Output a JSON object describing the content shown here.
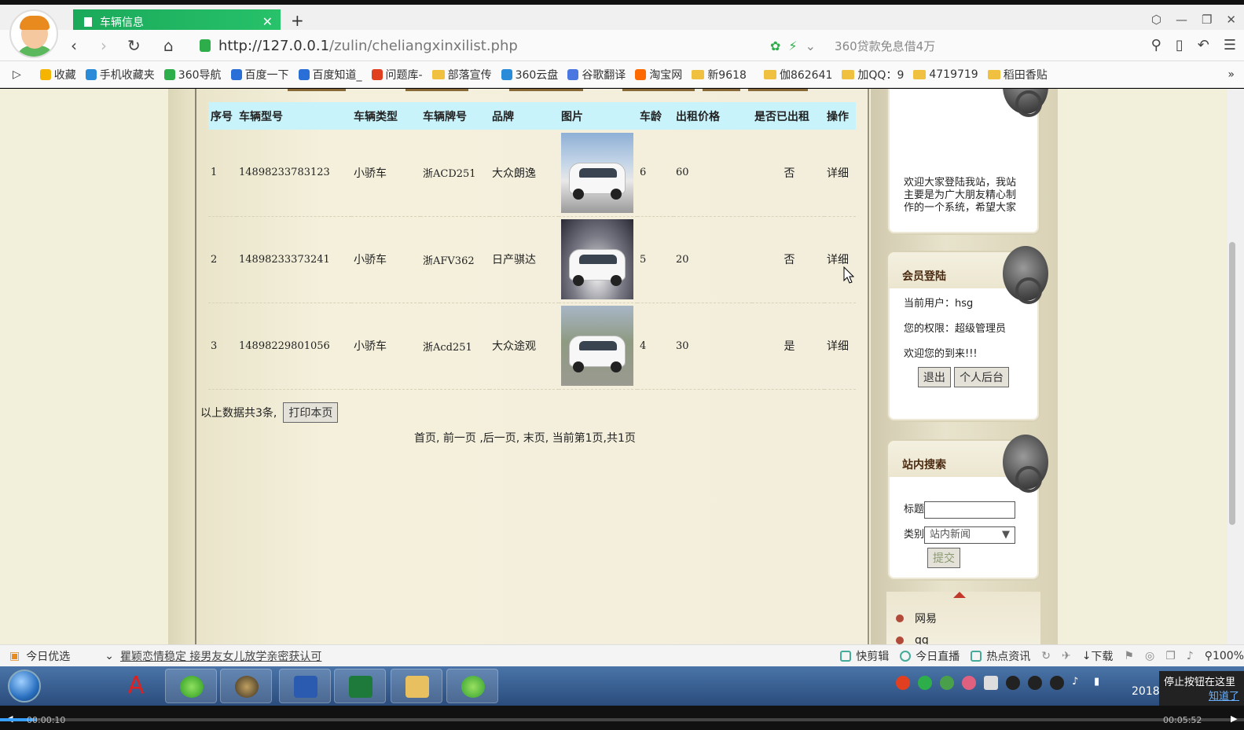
{
  "browser": {
    "tab_title": "车辆信息",
    "url_host": "http://127.0.0.1",
    "url_path": "/zulin/cheliangxinxilist.php",
    "ad_text": "360贷款免息借4万"
  },
  "bookmarks": [
    {
      "label": "收藏",
      "icon": "star-icon",
      "color": "#f5b400"
    },
    {
      "label": "手机收藏夹",
      "icon": "phone-icon",
      "color": "#2a8bd8"
    },
    {
      "label": "360导航",
      "icon": "plus-circle-icon",
      "color": "#2eae4b"
    },
    {
      "label": "百度一下",
      "icon": "paw-icon",
      "color": "#2a6ed8"
    },
    {
      "label": "百度知道_",
      "icon": "paw-icon",
      "color": "#2a6ed8"
    },
    {
      "label": "问题库-",
      "icon": "s-logo-icon",
      "color": "#e04020"
    },
    {
      "label": "部落宣传",
      "icon": "folder-icon",
      "color": "#f0c040"
    },
    {
      "label": "360云盘",
      "icon": "cloud-icon",
      "color": "#2a8bd8"
    },
    {
      "label": "谷歌翻译",
      "icon": "translate-icon",
      "color": "#4a78e0"
    },
    {
      "label": "淘宝网",
      "icon": "taobao-icon",
      "color": "#ff6a00"
    },
    {
      "label": "新9618",
      "icon": "folder-icon",
      "color": "#f0c040"
    },
    {
      "label": "伽862641",
      "icon": "folder-icon",
      "color": "#f0c040"
    },
    {
      "label": "加QQ：9",
      "icon": "folder-icon",
      "color": "#f0c040"
    },
    {
      "label": "4719719",
      "icon": "folder-icon",
      "color": "#f0c040"
    },
    {
      "label": "稻田香贴",
      "icon": "folder-icon",
      "color": "#f0c040"
    }
  ],
  "table": {
    "headers": [
      "序号",
      "车辆型号",
      "车辆类型",
      "车辆牌号",
      "品牌",
      "图片",
      "车龄",
      "出租价格",
      "是否已出租",
      "操作"
    ],
    "rows": [
      {
        "no": "1",
        "model": "14898233783123",
        "type": "小骄车",
        "plate": "浙ACD251",
        "brand": "大众朗逸",
        "age": "6",
        "price": "60",
        "rented": "否",
        "action": "详细"
      },
      {
        "no": "2",
        "model": "14898233373241",
        "type": "小骄车",
        "plate": "浙AFV362",
        "brand": "日产骐达",
        "age": "5",
        "price": "20",
        "rented": "否",
        "action": "详细"
      },
      {
        "no": "3",
        "model": "14898229801056",
        "type": "小骄车",
        "plate": "浙Acd251",
        "brand": "大众途观",
        "age": "4",
        "price": "30",
        "rented": "是",
        "action": "详细"
      }
    ]
  },
  "summary": {
    "text": "以上数据共3条,",
    "print_label": "打印本页"
  },
  "pager": {
    "text": "首页, 前一页 ,后一页, 末页, 当前第1页,共1页"
  },
  "sidebar": {
    "welcome_text": "欢迎大家登陆我站，我站主要是为广大朋友精心制作的一个系统，希望大家",
    "login": {
      "title": "会员登陆",
      "current_user": "当前用户：hsg",
      "permission": "您的权限：超级管理员",
      "welcome": "欢迎您的到来!!!",
      "logout_label": "退出",
      "backend_label": "个人后台"
    },
    "search": {
      "title": "站内搜索",
      "title_label": "标题",
      "category_label": "类别",
      "category_value": "站内新闻",
      "submit_label": "提交"
    },
    "links": [
      "网易",
      "qq"
    ]
  },
  "statusbar": {
    "today": "今日优选",
    "news": "瞿颖恋情稳定 接男友女儿放学亲密获认可",
    "items": [
      "快剪辑",
      "今日直播",
      "热点资讯",
      "下载"
    ],
    "zoom": "100%"
  },
  "taskbar": {
    "clock": "2018",
    "notice": "停止按钮在这里",
    "notice_link": "知道了"
  },
  "player": {
    "elapsed": "00:00:10",
    "total": "00:05:52",
    "progress": 0.03
  }
}
